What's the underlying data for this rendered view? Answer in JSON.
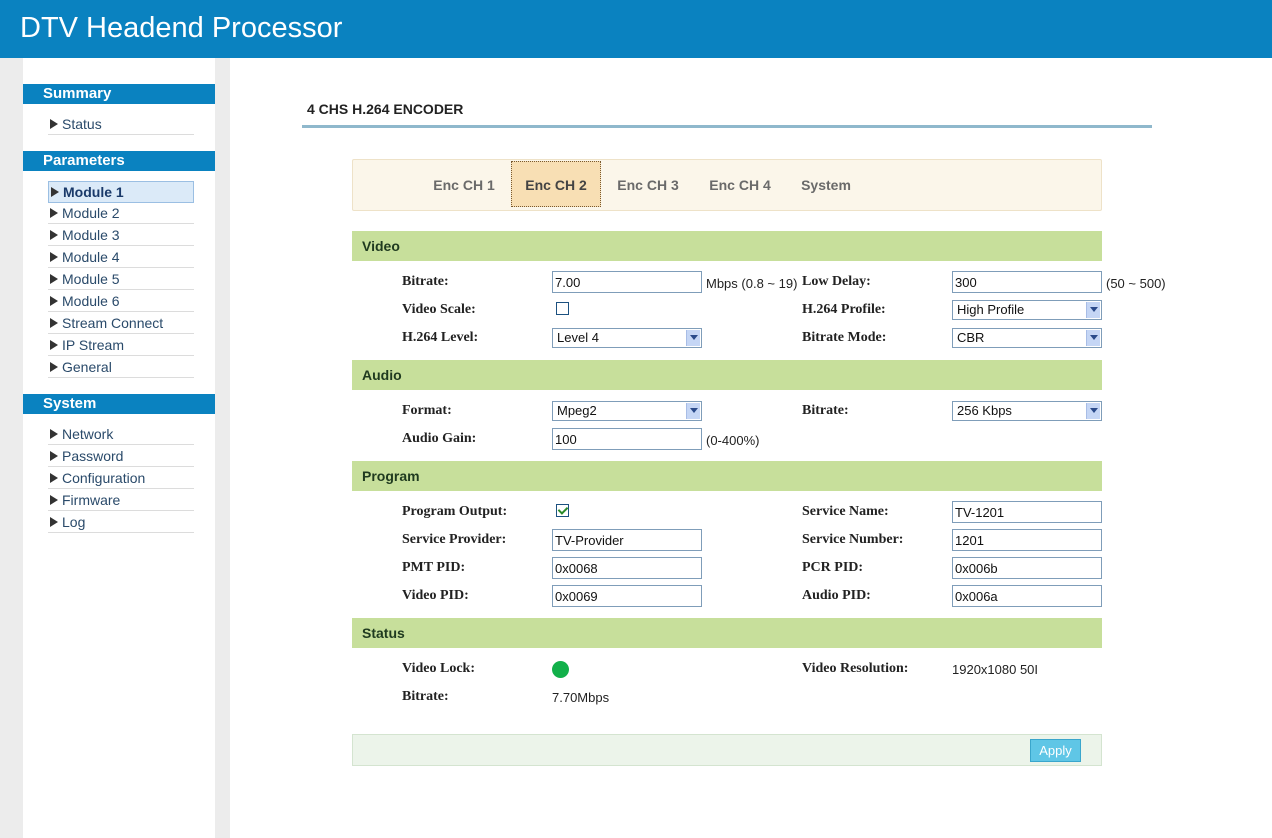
{
  "app_title": "DTV Headend Processor",
  "sidebar": {
    "summary": {
      "title": "Summary",
      "items": [
        "Status"
      ]
    },
    "parameters": {
      "title": "Parameters",
      "items": [
        "Module 1",
        "Module 2",
        "Module 3",
        "Module 4",
        "Module 5",
        "Module 6",
        "Stream Connect",
        "IP Stream",
        "General"
      ],
      "active": "Module 1"
    },
    "system": {
      "title": "System",
      "items": [
        "Network",
        "Password",
        "Configuration",
        "Firmware",
        "Log"
      ]
    }
  },
  "page_title": "4 CHS H.264 ENCODER",
  "tabs": [
    "Enc CH 1",
    "Enc CH 2",
    "Enc CH 3",
    "Enc CH 4",
    "System"
  ],
  "active_tab": "Enc CH 2",
  "video": {
    "title": "Video",
    "bitrate_label": "Bitrate:",
    "bitrate_value": "7.00",
    "bitrate_unit": "Mbps (0.8 ~ 19)",
    "low_delay_label": "Low Delay:",
    "low_delay_value": "300",
    "low_delay_unit": "(50 ~ 500)",
    "scale_label": "Video Scale:",
    "scale_checked": false,
    "profile_label": "H.264 Profile:",
    "profile_value": "High Profile",
    "level_label": "H.264 Level:",
    "level_value": "Level 4",
    "mode_label": "Bitrate Mode:",
    "mode_value": "CBR"
  },
  "audio": {
    "title": "Audio",
    "format_label": "Format:",
    "format_value": "Mpeg2",
    "bitrate_label": "Bitrate:",
    "bitrate_value": "256 Kbps",
    "gain_label": "Audio Gain:",
    "gain_value": "100",
    "gain_unit": "(0-400%)"
  },
  "program": {
    "title": "Program",
    "output_label": "Program Output:",
    "output_checked": true,
    "service_name_label": "Service Name:",
    "service_name_value": "TV-1201",
    "provider_label": "Service Provider:",
    "provider_value": "TV-Provider",
    "service_number_label": "Service Number:",
    "service_number_value": "1201",
    "pmt_label": "PMT PID:",
    "pmt_value": "0x0068",
    "pcr_label": "PCR PID:",
    "pcr_value": "0x006b",
    "video_pid_label": "Video PID:",
    "video_pid_value": "0x0069",
    "audio_pid_label": "Audio PID:",
    "audio_pid_value": "0x006a"
  },
  "status": {
    "title": "Status",
    "lock_label": "Video Lock:",
    "lock_color": "#12b04a",
    "resolution_label": "Video Resolution:",
    "resolution_value": "1920x1080 50I",
    "bitrate_label": "Bitrate:",
    "bitrate_value": "7.70Mbps"
  },
  "apply_label": "Apply"
}
